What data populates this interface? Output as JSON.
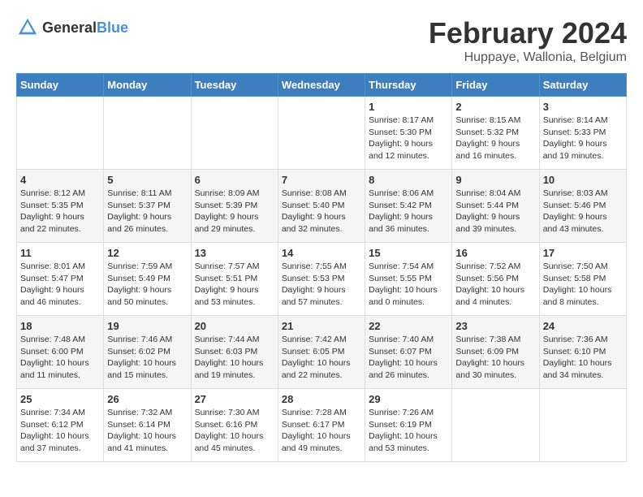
{
  "header": {
    "logo_general": "General",
    "logo_blue": "Blue",
    "title": "February 2024",
    "subtitle": "Huppaye, Wallonia, Belgium"
  },
  "days_of_week": [
    "Sunday",
    "Monday",
    "Tuesday",
    "Wednesday",
    "Thursday",
    "Friday",
    "Saturday"
  ],
  "weeks": [
    [
      {
        "day": "",
        "info": ""
      },
      {
        "day": "",
        "info": ""
      },
      {
        "day": "",
        "info": ""
      },
      {
        "day": "",
        "info": ""
      },
      {
        "day": "1",
        "info": "Sunrise: 8:17 AM\nSunset: 5:30 PM\nDaylight: 9 hours\nand 12 minutes."
      },
      {
        "day": "2",
        "info": "Sunrise: 8:15 AM\nSunset: 5:32 PM\nDaylight: 9 hours\nand 16 minutes."
      },
      {
        "day": "3",
        "info": "Sunrise: 8:14 AM\nSunset: 5:33 PM\nDaylight: 9 hours\nand 19 minutes."
      }
    ],
    [
      {
        "day": "4",
        "info": "Sunrise: 8:12 AM\nSunset: 5:35 PM\nDaylight: 9 hours\nand 22 minutes."
      },
      {
        "day": "5",
        "info": "Sunrise: 8:11 AM\nSunset: 5:37 PM\nDaylight: 9 hours\nand 26 minutes."
      },
      {
        "day": "6",
        "info": "Sunrise: 8:09 AM\nSunset: 5:39 PM\nDaylight: 9 hours\nand 29 minutes."
      },
      {
        "day": "7",
        "info": "Sunrise: 8:08 AM\nSunset: 5:40 PM\nDaylight: 9 hours\nand 32 minutes."
      },
      {
        "day": "8",
        "info": "Sunrise: 8:06 AM\nSunset: 5:42 PM\nDaylight: 9 hours\nand 36 minutes."
      },
      {
        "day": "9",
        "info": "Sunrise: 8:04 AM\nSunset: 5:44 PM\nDaylight: 9 hours\nand 39 minutes."
      },
      {
        "day": "10",
        "info": "Sunrise: 8:03 AM\nSunset: 5:46 PM\nDaylight: 9 hours\nand 43 minutes."
      }
    ],
    [
      {
        "day": "11",
        "info": "Sunrise: 8:01 AM\nSunset: 5:47 PM\nDaylight: 9 hours\nand 46 minutes."
      },
      {
        "day": "12",
        "info": "Sunrise: 7:59 AM\nSunset: 5:49 PM\nDaylight: 9 hours\nand 50 minutes."
      },
      {
        "day": "13",
        "info": "Sunrise: 7:57 AM\nSunset: 5:51 PM\nDaylight: 9 hours\nand 53 minutes."
      },
      {
        "day": "14",
        "info": "Sunrise: 7:55 AM\nSunset: 5:53 PM\nDaylight: 9 hours\nand 57 minutes."
      },
      {
        "day": "15",
        "info": "Sunrise: 7:54 AM\nSunset: 5:55 PM\nDaylight: 10 hours\nand 0 minutes."
      },
      {
        "day": "16",
        "info": "Sunrise: 7:52 AM\nSunset: 5:56 PM\nDaylight: 10 hours\nand 4 minutes."
      },
      {
        "day": "17",
        "info": "Sunrise: 7:50 AM\nSunset: 5:58 PM\nDaylight: 10 hours\nand 8 minutes."
      }
    ],
    [
      {
        "day": "18",
        "info": "Sunrise: 7:48 AM\nSunset: 6:00 PM\nDaylight: 10 hours\nand 11 minutes."
      },
      {
        "day": "19",
        "info": "Sunrise: 7:46 AM\nSunset: 6:02 PM\nDaylight: 10 hours\nand 15 minutes."
      },
      {
        "day": "20",
        "info": "Sunrise: 7:44 AM\nSunset: 6:03 PM\nDaylight: 10 hours\nand 19 minutes."
      },
      {
        "day": "21",
        "info": "Sunrise: 7:42 AM\nSunset: 6:05 PM\nDaylight: 10 hours\nand 22 minutes."
      },
      {
        "day": "22",
        "info": "Sunrise: 7:40 AM\nSunset: 6:07 PM\nDaylight: 10 hours\nand 26 minutes."
      },
      {
        "day": "23",
        "info": "Sunrise: 7:38 AM\nSunset: 6:09 PM\nDaylight: 10 hours\nand 30 minutes."
      },
      {
        "day": "24",
        "info": "Sunrise: 7:36 AM\nSunset: 6:10 PM\nDaylight: 10 hours\nand 34 minutes."
      }
    ],
    [
      {
        "day": "25",
        "info": "Sunrise: 7:34 AM\nSunset: 6:12 PM\nDaylight: 10 hours\nand 37 minutes."
      },
      {
        "day": "26",
        "info": "Sunrise: 7:32 AM\nSunset: 6:14 PM\nDaylight: 10 hours\nand 41 minutes."
      },
      {
        "day": "27",
        "info": "Sunrise: 7:30 AM\nSunset: 6:16 PM\nDaylight: 10 hours\nand 45 minutes."
      },
      {
        "day": "28",
        "info": "Sunrise: 7:28 AM\nSunset: 6:17 PM\nDaylight: 10 hours\nand 49 minutes."
      },
      {
        "day": "29",
        "info": "Sunrise: 7:26 AM\nSunset: 6:19 PM\nDaylight: 10 hours\nand 53 minutes."
      },
      {
        "day": "",
        "info": ""
      },
      {
        "day": "",
        "info": ""
      }
    ]
  ]
}
